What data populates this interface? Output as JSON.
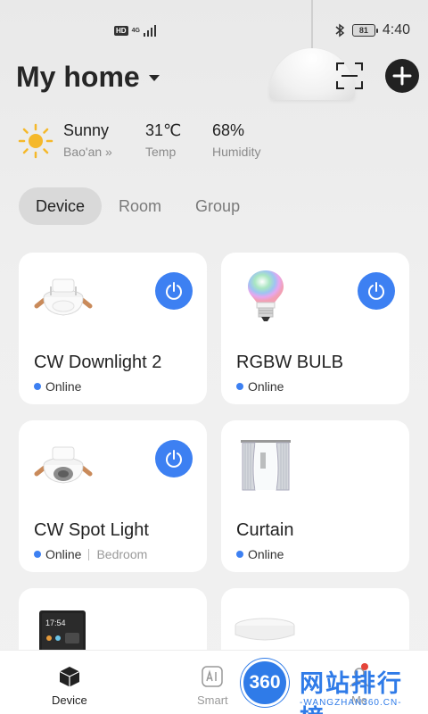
{
  "status_bar": {
    "hd": "HD",
    "network": "4G",
    "battery": "81",
    "time": "4:40"
  },
  "header": {
    "title": "My home",
    "scan_icon": "scan-icon",
    "add_icon": "plus-icon"
  },
  "weather": {
    "condition": "Sunny",
    "location": "Bao'an",
    "temp_value": "31℃",
    "temp_label": "Temp",
    "humidity_value": "68%",
    "humidity_label": "Humidity"
  },
  "tabs": [
    {
      "label": "Device",
      "active": true
    },
    {
      "label": "Room",
      "active": false
    },
    {
      "label": "Group",
      "active": false
    }
  ],
  "devices": [
    {
      "name": "CW Downlight 2",
      "status": "Online",
      "room": "",
      "has_power": true
    },
    {
      "name": "RGBW BULB",
      "status": "Online",
      "room": "",
      "has_power": true
    },
    {
      "name": "CW Spot Light",
      "status": "Online",
      "room": "Bedroom",
      "has_power": true
    },
    {
      "name": "Curtain",
      "status": "Online",
      "room": "",
      "has_power": false
    },
    {
      "name": "",
      "status": "",
      "room": "",
      "has_power": false
    },
    {
      "name": "",
      "status": "",
      "room": "",
      "has_power": false
    }
  ],
  "device5_screen_time": "17:54",
  "nav": [
    {
      "label": "Device",
      "icon": "cube-icon",
      "active": true
    },
    {
      "label": "Smart",
      "icon": "ai-icon",
      "active": false
    },
    {
      "label": "Me",
      "icon": "person-icon",
      "active": false
    }
  ],
  "watermark": {
    "badge": "360",
    "text": "网站排行榜",
    "url": "-WANGZHAN360.CN-"
  },
  "colors": {
    "accent": "#3d80f2",
    "online_dot": "#3d80f2",
    "background": "#eeeeee"
  }
}
